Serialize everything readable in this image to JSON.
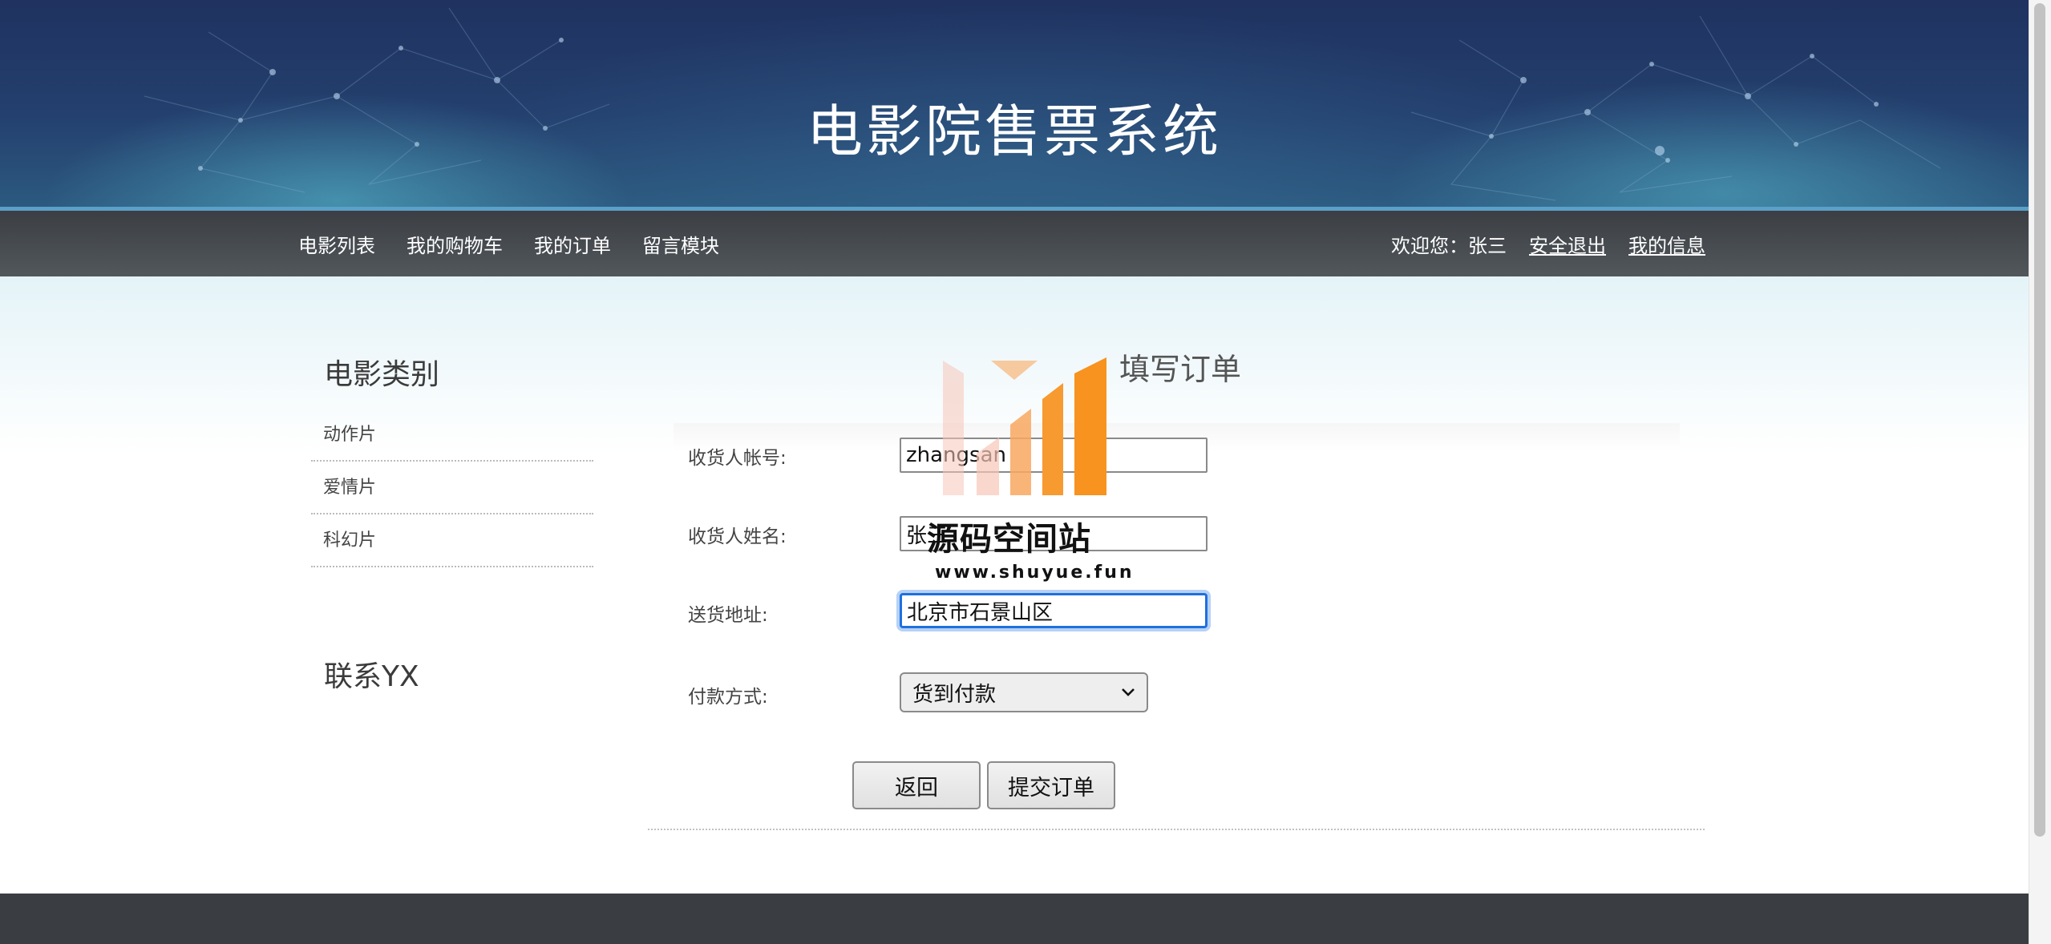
{
  "header": {
    "site_title": "电影院售票系统"
  },
  "nav": {
    "items": [
      {
        "label": "电影列表"
      },
      {
        "label": "我的购物车"
      },
      {
        "label": "我的订单"
      },
      {
        "label": "留言模块"
      }
    ],
    "welcome": "欢迎您：张三",
    "logout": "安全退出",
    "my_info": "我的信息"
  },
  "sidebar": {
    "category_title": "电影类别",
    "categories": [
      {
        "label": "动作片"
      },
      {
        "label": "爱情片"
      },
      {
        "label": "科幻片"
      }
    ],
    "contact_title": "联系YX"
  },
  "form": {
    "title": "填写订单",
    "account_label": "收货人帐号:",
    "account_value": "zhangsan",
    "name_label": "收货人姓名:",
    "name_value": "张三",
    "address_label": "送货地址:",
    "address_value": "北京市石景山区",
    "payment_label": "付款方式:",
    "payment_value": "货到付款",
    "back_button": "返回",
    "submit_button": "提交订单"
  },
  "watermark": {
    "text": "源码空间站",
    "url": "www.shuyue.fun"
  },
  "colors": {
    "banner": "#1f3260",
    "nav_bar": "#4a4e53",
    "focus_ring": "#1f6fe0",
    "watermark_orange": "#f7931e"
  }
}
